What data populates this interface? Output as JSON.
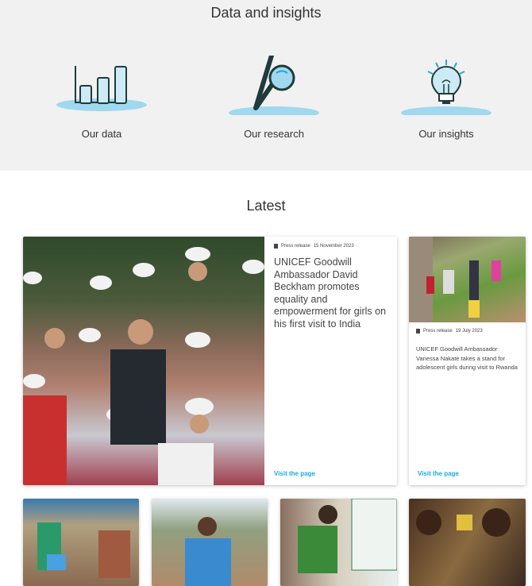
{
  "insights": {
    "title": "Data and insights",
    "tiles": [
      {
        "label": "Our data",
        "icon": "bar-chart-icon"
      },
      {
        "label": "Our research",
        "icon": "magnifier-icon"
      },
      {
        "label": "Our insights",
        "icon": "lightbulb-icon"
      }
    ]
  },
  "latest": {
    "title": "Latest",
    "featured": {
      "type": "Press release",
      "date": "15 November 2023",
      "title": "UNICEF Goodwill Ambassador David Beckham promotes equality and empowerment for girls on his first visit to India",
      "link": "Visit the page"
    },
    "second": {
      "type": "Press release",
      "date": "19 July 2023",
      "title": "UNICEF Goodwill Ambassador Vanessa Nakate takes a stand for adolescent girls during visit to Rwanda",
      "link": "Visit the page"
    }
  },
  "colors": {
    "accent": "#1cabe2",
    "ellipse": "#9fd8ef",
    "gray_bg": "#f1f1f1"
  }
}
